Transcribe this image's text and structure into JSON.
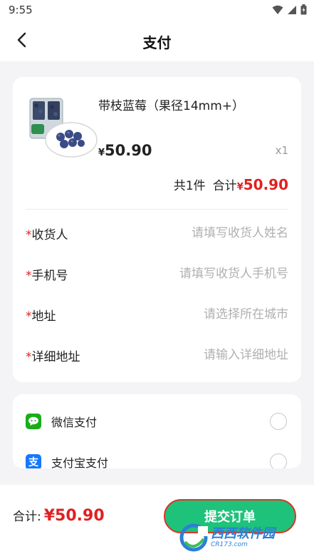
{
  "status_bar": {
    "time": "9:55"
  },
  "header": {
    "title": "支付"
  },
  "product": {
    "name": "带枝蓝莓（果径14mm+）",
    "currency": "¥",
    "price": "50.90",
    "quantity": "x1"
  },
  "summary": {
    "count_text": "共1件",
    "total_label": "合计",
    "currency": "¥",
    "total": "50.90"
  },
  "form": {
    "required_mark": "*",
    "rows": [
      {
        "label": "收货人",
        "placeholder": "请填写收货人姓名"
      },
      {
        "label": "手机号",
        "placeholder": "请填写收货人手机号"
      },
      {
        "label": "地址",
        "placeholder": "请选择所在城市"
      },
      {
        "label": "详细地址",
        "placeholder": "请输入详细地址"
      }
    ]
  },
  "payment": {
    "methods": [
      {
        "label": "微信支付",
        "icon": "wechat-pay-icon",
        "color": "#1aad19"
      },
      {
        "label": "支付宝支付",
        "icon": "alipay-icon",
        "color": "#1677ff"
      }
    ]
  },
  "bottom": {
    "total_label": "合计:",
    "total_price": "¥50.90",
    "submit_label": "提交订单"
  },
  "watermark": {
    "main": "西西软件园",
    "sub": "CR173.com"
  },
  "colors": {
    "accent_green": "#1ec27a",
    "price_red": "#e02020",
    "background": "#f4f4f6"
  }
}
